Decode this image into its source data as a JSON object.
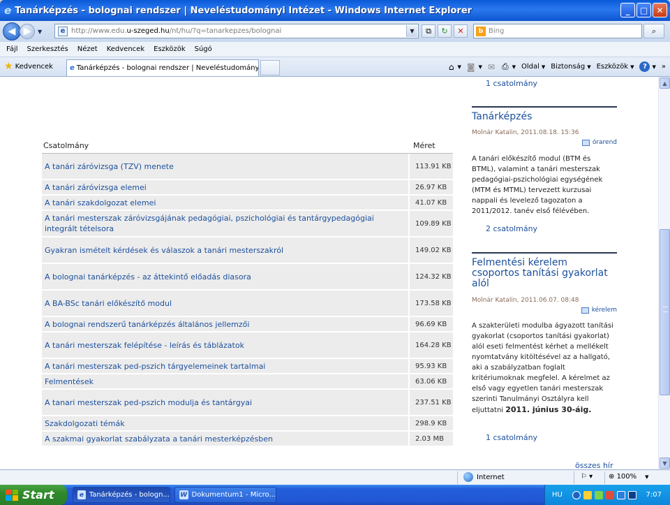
{
  "window": {
    "title": "Tanárképzés - bolognai rendszer | Neveléstudományi Intézet - Windows Internet Explorer",
    "controls": [
      "_",
      "□",
      "✕"
    ]
  },
  "address": {
    "url_prefix": "http://www.edu.",
    "url_domain": "u-szeged.hu",
    "url_suffix": "/nt/hu/?q=tanarkepzes/bolognai",
    "search_placeholder": "Bing"
  },
  "menu": [
    "Fájl",
    "Szerkesztés",
    "Nézet",
    "Kedvencek",
    "Eszközök",
    "Súgó"
  ],
  "favorites": {
    "label": "Kedvencek",
    "tab_title": "Tanárképzés - bolognai rendszer | Neveléstudományi ..."
  },
  "command_bar": {
    "page": "Oldal",
    "safety": "Biztonság",
    "tools": "Eszközök"
  },
  "attachments": {
    "header_name": "Csatolmány",
    "header_size": "Méret",
    "rows": [
      {
        "name": "A tanári záróvizsga (TZV) menete",
        "size": "113.91 KB"
      },
      {
        "name": "A tanári záróvizsga elemei",
        "size": "26.97 KB"
      },
      {
        "name": "A tanári szakdolgozat elemei",
        "size": "41.07 KB"
      },
      {
        "name": "A tanári mesterszak záróvizsgájának pedagógiai, pszichológiai és tantárgypedagógiai integrált tételsora",
        "size": "109.89 KB"
      },
      {
        "name": "Gyakran ismételt kérdések és válaszok a tanári mesterszakról",
        "size": "149.02 KB"
      },
      {
        "name": "A bolognai tanárképzés - az áttekintő előadás diasora",
        "size": "124.32 KB"
      },
      {
        "name": "A BA-BSc tanári előkészítő modul",
        "size": "173.58 KB"
      },
      {
        "name": "A bolognai rendszerű tanárképzés általános jellemzői",
        "size": "96.69 KB"
      },
      {
        "name": "A tanári mesterszak felépítése - leírás és táblázatok",
        "size": "164.28 KB"
      },
      {
        "name": "A tanári mesterszak ped-pszich tárgyelemeinek tartalmai",
        "size": "95.93 KB"
      },
      {
        "name": "Felmentések",
        "size": "63.06 KB"
      },
      {
        "name": "A tanari mesterszak ped-pszich modulja és tantárgyai",
        "size": "237.51 KB"
      },
      {
        "name": "Szakdolgozati témák",
        "size": "298.9 KB"
      },
      {
        "name": "A szakmai gyakorlat szabályzata a tanári mesterképzésben",
        "size": "2.03 MB"
      }
    ]
  },
  "sidebar": {
    "top_link": "1 csatolmány",
    "post1": {
      "title": "Tanárképzés",
      "meta": "Molnár Katalin, 2011.08.18. 15:36",
      "tag": "órarend",
      "text": "A tanári előkészítő modul (BTM és BTML), valamint a tanári mesterszak pedagógiai-pszichológiai egységének (MTM és MTML) tervezett kurzusai nappali és levelező tagozaton a 2011/2012. tanév első félévében.",
      "link": "2 csatolmány"
    },
    "post2": {
      "title": "Felmentési kérelem csoportos tanítási gyakorlat alól",
      "meta": "Molnár Katalin, 2011.06.07. 08:48",
      "tag": "kérelem",
      "text": "A szakterületi modulba ágyazott tanítási gyakorlat (csoportos tanítási gyakorlat) alól eseti felmentést kérhet a mellékelt nyomtatvány kitöltésével az a hallgató, aki a szabályzatban foglalt kritériumoknak megfelel. A kérelmet az első vagy egyetlen tanári mesterszak szerinti Tanulmányi Osztályra kell eljuttatni",
      "deadline": "2011. június 30-áig.",
      "link": "1 csatolmány"
    },
    "bottom_link": "összes hír"
  },
  "status": {
    "zone": "Internet",
    "zoom": "100%"
  },
  "taskbar": {
    "start": "Start",
    "task1": "Tanárképzés - bologn...",
    "task2": "Dokumentum1 - Micro...",
    "lang": "HU",
    "clock": "7:07"
  }
}
